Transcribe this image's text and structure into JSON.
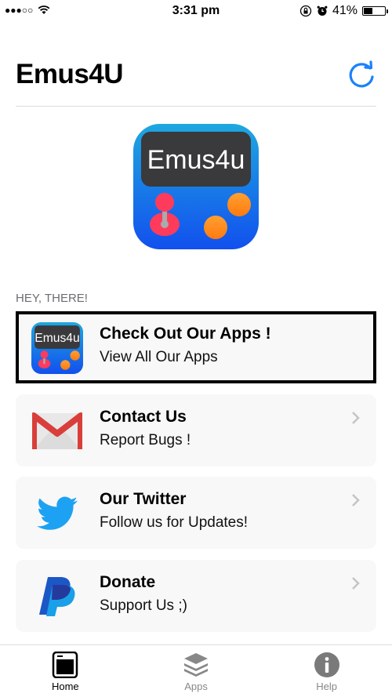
{
  "status_bar": {
    "signal": "●●●○○",
    "time": "3:31 pm",
    "battery_percent_label": "41%",
    "battery_level": 0.41
  },
  "header": {
    "title": "Emus4U",
    "refresh_icon": "refresh-icon"
  },
  "hero": {
    "logo_text": "Emus4u"
  },
  "section_label": "HEY, THERE!",
  "cards": [
    {
      "title": "Check Out Our Apps !",
      "subtitle": "View All Our Apps",
      "icon": "emus4u-logo-icon",
      "logo_text": "Emus4u",
      "selected": true
    },
    {
      "title": "Contact Us",
      "subtitle": "Report Bugs !",
      "icon": "gmail-icon"
    },
    {
      "title": "Our Twitter",
      "subtitle": "Follow us for Updates!",
      "icon": "twitter-icon"
    },
    {
      "title": "Donate",
      "subtitle": "Support Us ;)",
      "icon": "paypal-icon"
    }
  ],
  "tabs": [
    {
      "label": "Home",
      "icon": "home-icon",
      "active": true
    },
    {
      "label": "Apps",
      "icon": "layers-icon"
    },
    {
      "label": "Help",
      "icon": "info-icon"
    }
  ],
  "colors": {
    "accent": "#1a82fb",
    "card_bg": "#f8f8f8",
    "section_label": "#6d6d72",
    "twitter": "#1da1f2",
    "tab_inactive": "#888888"
  }
}
